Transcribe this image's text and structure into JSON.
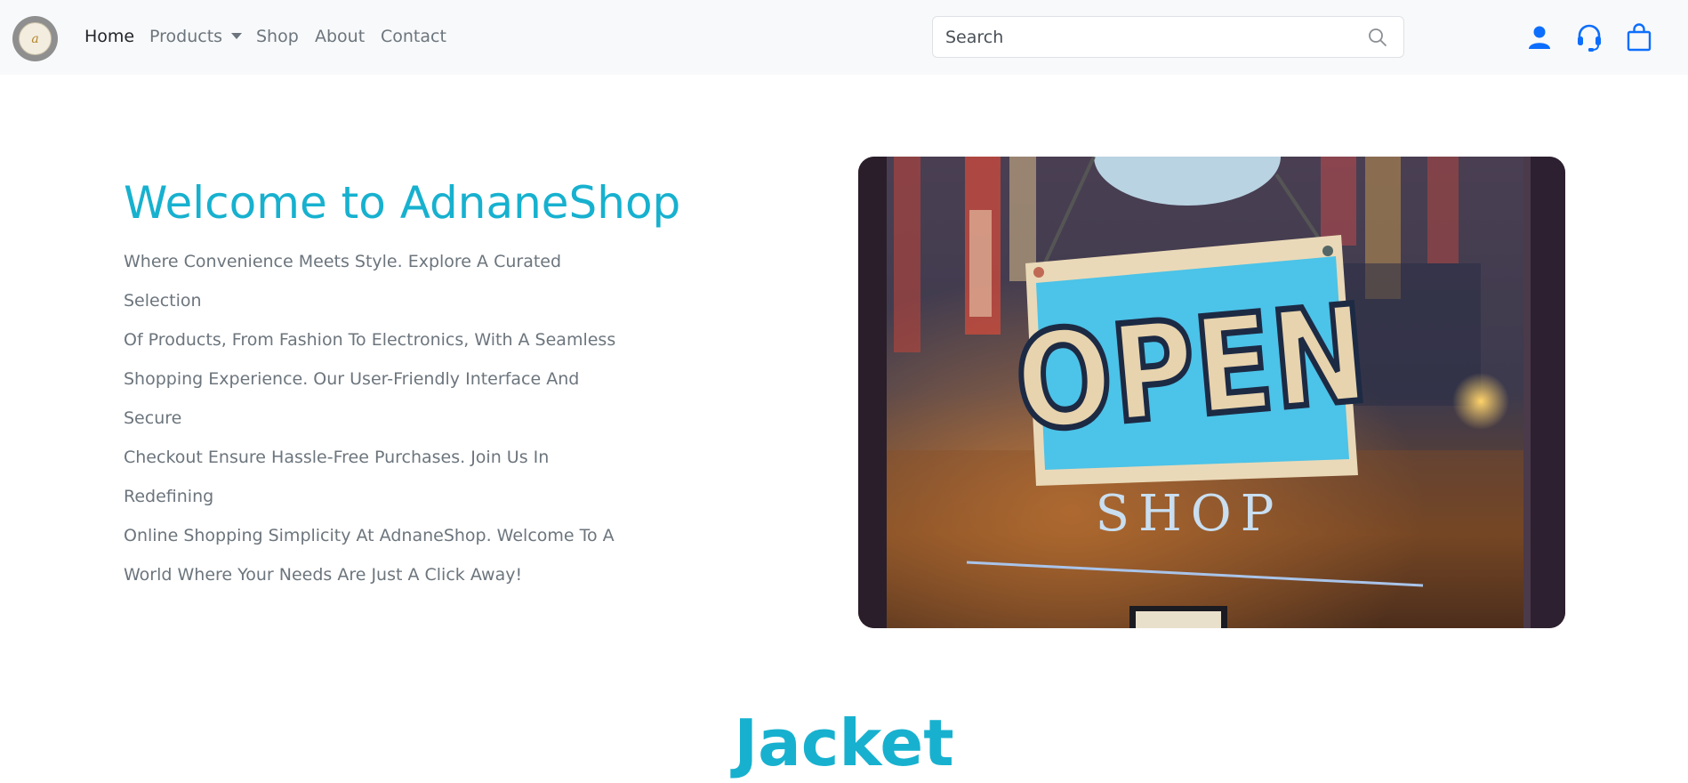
{
  "brand": {
    "logo_name": "adnaneshop-logo",
    "accent_color": "#17b1cf"
  },
  "nav": {
    "items": [
      {
        "label": "Home",
        "active": true
      },
      {
        "label": "Products",
        "dropdown": true
      },
      {
        "label": "Shop"
      },
      {
        "label": "About"
      },
      {
        "label": "Contact"
      }
    ]
  },
  "search": {
    "placeholder": "Search",
    "value": "",
    "icon": "search-icon"
  },
  "actions": {
    "icons": [
      "user-icon",
      "headset-icon",
      "shopping-bag-icon"
    ],
    "color": "#0d6efd"
  },
  "hero": {
    "title": "Welcome to AdnaneShop",
    "lines": [
      "Where Convenience Meets Style. Explore A Curated Selection",
      "Of Products, From Fashion To Electronics, With A Seamless",
      "Shopping Experience. Our User-Friendly Interface And Secure",
      "Checkout Ensure Hassle-Free Purchases. Join Us In Redefining",
      "Online Shopping Simplicity At AdnaneShop. Welcome To A",
      "World Where Your Needs Are Just A Click Away!"
    ],
    "image": {
      "sign_text": "OPEN",
      "sub_text": "SHOP"
    }
  },
  "section": {
    "title": "Jacket"
  }
}
